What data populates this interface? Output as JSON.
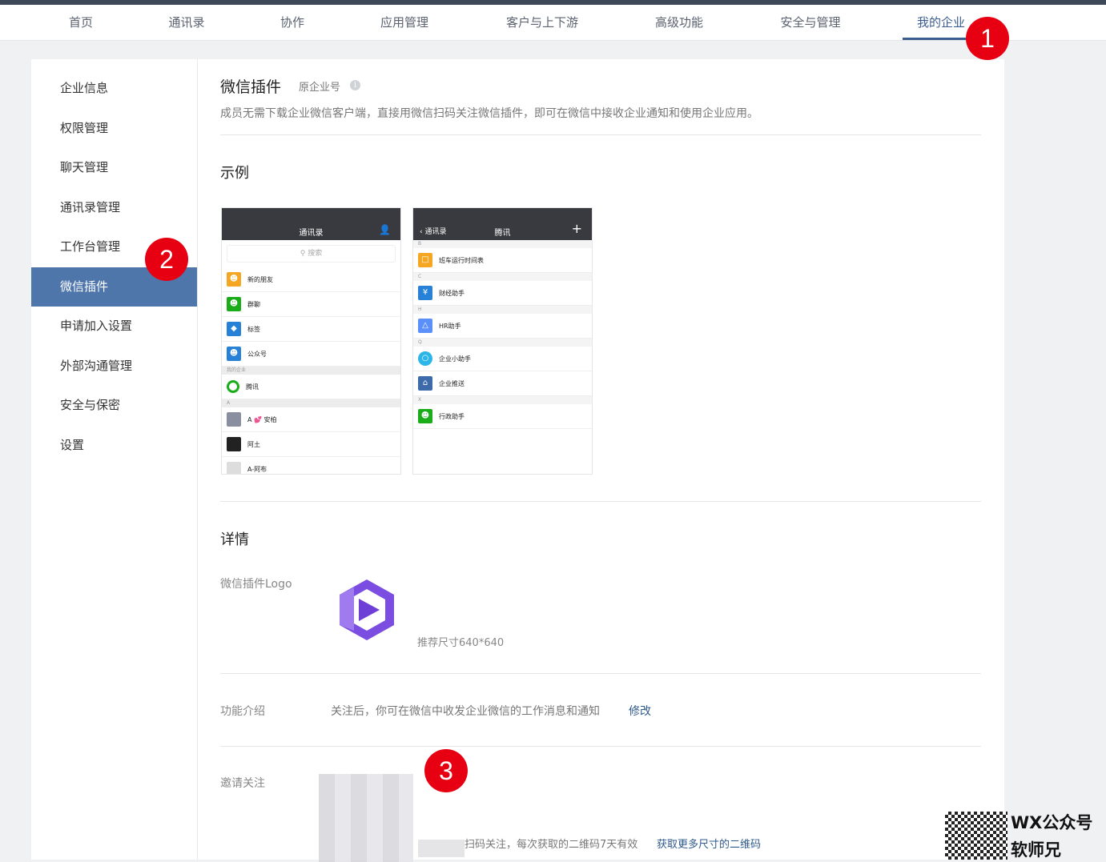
{
  "topnav": {
    "items": [
      "首页",
      "通讯录",
      "协作",
      "应用管理",
      "客户与上下游",
      "高级功能",
      "安全与管理",
      "我的企业"
    ],
    "active_index": 7
  },
  "markers": [
    "1",
    "2",
    "3"
  ],
  "sidebar": {
    "items": [
      "企业信息",
      "权限管理",
      "聊天管理",
      "通讯录管理",
      "工作台管理",
      "微信插件",
      "申请加入设置",
      "外部沟通管理",
      "安全与保密",
      "设置"
    ],
    "active_index": 5
  },
  "main": {
    "title": "微信插件",
    "title_tag": "原企业号",
    "info_icon": "i",
    "description": "成员无需下载企业微信客户端，直接用微信扫码关注微信插件，即可在微信中接收企业通知和使用企业应用。",
    "example_title": "示例",
    "detail_title": "详情",
    "logo_label": "微信插件Logo",
    "logo_hint": "推荐尺寸640*640",
    "feature_label": "功能介绍",
    "feature_value": "关注后，你可在微信中收发企业微信的工作消息和通知",
    "feature_link": "修改",
    "invite_label": "邀请关注",
    "invite_hint": "扫码关注，每次获取的二维码7天有效",
    "invite_link": "获取更多尺寸的二维码"
  },
  "phone1": {
    "title": "通讯录",
    "search_placeholder": "搜索",
    "rows": [
      {
        "label": "新的朋友",
        "color": "#f5a623"
      },
      {
        "label": "群聊",
        "color": "#1aad19"
      },
      {
        "label": "标签",
        "color": "#2782d7"
      },
      {
        "label": "公众号",
        "color": "#2782d7"
      }
    ],
    "group1": "我的企业",
    "company": "腾讯",
    "group2": "A",
    "contacts": [
      "A 💕 安柏",
      "阿土",
      "A-阿布"
    ]
  },
  "phone2": {
    "back": "通讯录",
    "title": "腾讯",
    "plus": "+",
    "groups": [
      {
        "letter": "B",
        "items": [
          {
            "label": "班车运行时间表",
            "color": "#f5a623"
          }
        ]
      },
      {
        "letter": "C",
        "items": [
          {
            "label": "财经助手",
            "color": "#2782d7"
          }
        ]
      },
      {
        "letter": "H",
        "items": [
          {
            "label": "HR助手",
            "color": "#5b8ff9"
          }
        ]
      },
      {
        "letter": "Q",
        "items": [
          {
            "label": "企业小助手",
            "color": "#2bb5e8"
          },
          {
            "label": "企业推送",
            "color": "#3d6aa8"
          }
        ]
      },
      {
        "letter": "X",
        "items": [
          {
            "label": "行政助手",
            "color": "#1aad19"
          }
        ]
      }
    ]
  },
  "watermark": {
    "line1": "WX公众号",
    "line2": "软师兄"
  },
  "colors": {
    "accent": "#4e76ab",
    "nav_active": "#3b5c8f",
    "marker": "#e60012",
    "logo": "#7b4de0"
  }
}
